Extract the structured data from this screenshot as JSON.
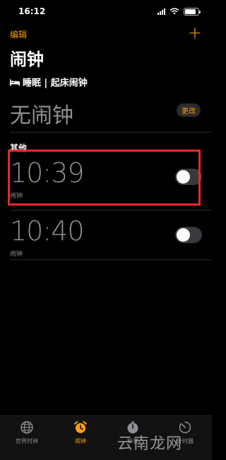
{
  "status_bar": {
    "time": "16:12"
  },
  "nav": {
    "edit_label": "编辑",
    "add_label": "+"
  },
  "title": "闹钟",
  "sleep": {
    "header": "睡眠 | 起床闹钟",
    "no_alarm_text": "无闹钟",
    "change_label": "更改"
  },
  "others": {
    "header": "其他",
    "alarms": [
      {
        "time": "10:39",
        "label": "闹钟",
        "enabled": false
      },
      {
        "time": "10:40",
        "label": "闹钟",
        "enabled": false
      }
    ]
  },
  "tabs": [
    {
      "label": "世界时钟",
      "icon": "globe-icon",
      "active": false
    },
    {
      "label": "闹钟",
      "icon": "alarm-clock-icon",
      "active": true
    },
    {
      "label": "秒表",
      "icon": "stopwatch-icon",
      "active": false
    },
    {
      "label": "计时器",
      "icon": "timer-icon",
      "active": false
    }
  ],
  "watermark": "云南龙网",
  "colors": {
    "accent": "#ff9f0a",
    "highlight": "#e8282b",
    "background": "#000000"
  }
}
